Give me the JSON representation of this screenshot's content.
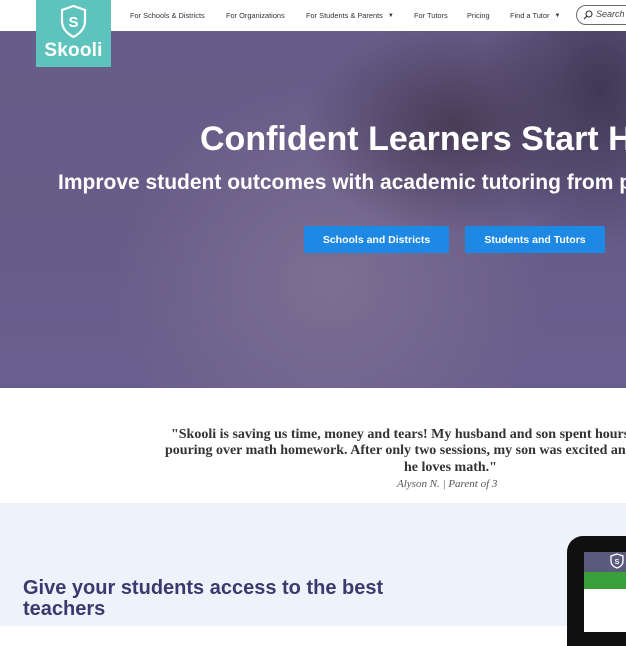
{
  "brand": {
    "logo_text": "Skooli",
    "logo_color": "#5ec3bc"
  },
  "nav": {
    "items": [
      {
        "label": "For Schools & Districts",
        "has_dropdown": false
      },
      {
        "label": "For Organizations",
        "has_dropdown": false
      },
      {
        "label": "For Students & Parents",
        "has_dropdown": true
      },
      {
        "label": "For Tutors",
        "has_dropdown": false
      },
      {
        "label": "Pricing",
        "has_dropdown": false
      },
      {
        "label": "Find a Tutor",
        "has_dropdown": true
      }
    ],
    "dropdown_icon": "caret-down",
    "search_placeholder": "Search"
  },
  "hero": {
    "title": "Confident Learners Start Here",
    "subtitle": "Improve student outcomes with academic tutoring from professionals",
    "buttons": {
      "schools": "Schools and Districts",
      "students": "Students and Tutors"
    },
    "button_color": "#1e88e5"
  },
  "testimonial": {
    "line1": "\"Skooli is saving us time, money and tears! My husband and son spent hours",
    "line2": "pouring over math homework. After only two sessions, my son was excited and",
    "line3": "he loves math.\"",
    "author": "Alyson N.",
    "separator": "|",
    "role": "Parent of 3"
  },
  "teachers": {
    "heading": "Give your students access to the best teachers"
  }
}
